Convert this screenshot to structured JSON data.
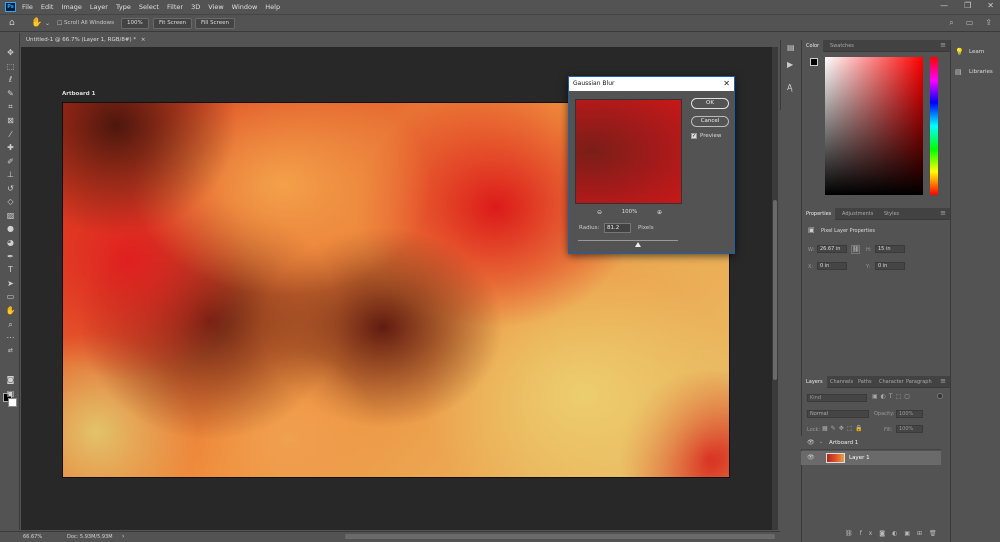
{
  "app": {
    "logo": "Ps",
    "menu": [
      "File",
      "Edit",
      "Image",
      "Layer",
      "Type",
      "Select",
      "Filter",
      "3D",
      "View",
      "Window",
      "Help"
    ]
  },
  "options_bar": {
    "scroll_all_windows": "Scroll All Windows",
    "zoom_100": "100%",
    "fit_screen": "Fit Screen",
    "fill_screen": "Fill Screen"
  },
  "document": {
    "tab_title": "Untitled-1 @ 66.7% (Layer 1, RGB/8#) *",
    "tab_close": "×",
    "artboard_label": "Artboard 1"
  },
  "status_bar": {
    "zoom": "66.67%",
    "doc_size": "Doc: 5.93M/5.93M"
  },
  "color_panel": {
    "tabs": [
      "Color",
      "Swatches"
    ],
    "foreground": "#000000",
    "background": "#ffffff",
    "picker_hue": "#ff0000"
  },
  "properties_panel": {
    "tabs": [
      "Properties",
      "Adjustments",
      "Styles"
    ],
    "section_title": "Pixel Layer Properties",
    "w_label": "W:",
    "w_value": "26.67 in",
    "h_label": "H:",
    "h_value": "15 in",
    "x_label": "X:",
    "x_value": "0 in",
    "y_label": "Y:",
    "y_value": "0 in"
  },
  "layers_panel": {
    "tabs": [
      "Layers",
      "Channels",
      "Paths",
      "Character",
      "Paragraph"
    ],
    "filter_placeholder": "Kind",
    "blend_mode": "Normal",
    "opacity_label": "Opacity:",
    "opacity_value": "100%",
    "lock_label": "Lock:",
    "fill_label": "Fill:",
    "fill_value": "100%",
    "layers": [
      {
        "name": "Artboard 1",
        "type": "artboard"
      },
      {
        "name": "Layer 1",
        "type": "pixel",
        "selected": true
      }
    ]
  },
  "learn_panel": {
    "items": [
      "Learn",
      "Libraries"
    ]
  },
  "dialog": {
    "title": "Gaussian Blur",
    "ok": "OK",
    "cancel": "Cancel",
    "preview_label": "Preview",
    "preview_checked": true,
    "zoom_out": "⊖",
    "zoom_level": "100%",
    "zoom_in": "⊕",
    "radius_label": "Radius:",
    "radius_value": "81.2",
    "radius_unit": "Pixels"
  }
}
